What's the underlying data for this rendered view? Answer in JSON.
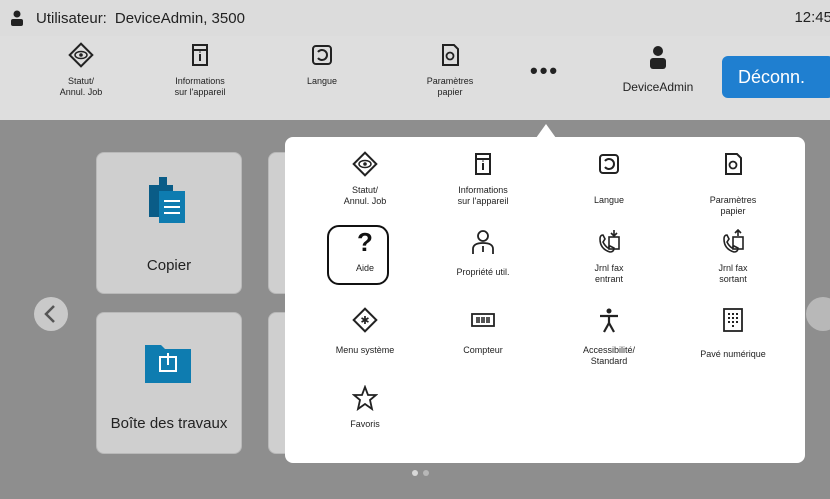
{
  "statusbar": {
    "user_label": "Utilisateur:",
    "user_name": "DeviceAdmin, 3500",
    "time": "12:45"
  },
  "toolbar": {
    "items": [
      {
        "label_line1": "Statut/",
        "label_line2": "Annul. Job",
        "icon": "eye-icon"
      },
      {
        "label_line1": "Informations",
        "label_line2": "sur l'appareil",
        "icon": "device-info-icon"
      },
      {
        "label_line1": "Langue",
        "label_line2": "",
        "icon": "language-icon"
      },
      {
        "label_line1": "Paramètres",
        "label_line2": "papier",
        "icon": "paper-settings-icon"
      }
    ],
    "more": "•••",
    "admin_label": "DeviceAdmin",
    "logout_label": "Déconn."
  },
  "home": {
    "tiles": [
      {
        "label": "Copier"
      },
      {
        "label": "Boîte des travaux"
      }
    ]
  },
  "popup": {
    "items": [
      {
        "label_line1": "Statut/",
        "label_line2": "Annul. Job",
        "icon": "eye-icon"
      },
      {
        "label_line1": "Informations",
        "label_line2": "sur l'appareil",
        "icon": "device-info-icon"
      },
      {
        "label_line1": "Langue",
        "label_line2": "",
        "icon": "language-icon"
      },
      {
        "label_line1": "Paramètres",
        "label_line2": "papier",
        "icon": "paper-settings-icon"
      },
      {
        "label_line1": "Aide",
        "label_line2": "",
        "icon": "help-icon"
      },
      {
        "label_line1": "Propriété util.",
        "label_line2": "",
        "icon": "user-property-icon"
      },
      {
        "label_line1": "Jrnl fax",
        "label_line2": "entrant",
        "icon": "fax-in-log-icon"
      },
      {
        "label_line1": "Jrnl fax",
        "label_line2": "sortant",
        "icon": "fax-out-log-icon"
      },
      {
        "label_line1": "Menu système",
        "label_line2": "",
        "icon": "system-menu-icon"
      },
      {
        "label_line1": "Compteur",
        "label_line2": "",
        "icon": "counter-icon"
      },
      {
        "label_line1": "Accessibilité/",
        "label_line2": "Standard",
        "icon": "accessibility-icon"
      },
      {
        "label_line1": "Pavé numérique",
        "label_line2": "",
        "icon": "keypad-icon"
      },
      {
        "label_line1": "Favoris",
        "label_line2": "",
        "icon": "star-icon"
      }
    ]
  },
  "colors": {
    "accent": "#1f7fd0",
    "statusbar": "#dcdcdc",
    "background": "#8e8e8e"
  }
}
